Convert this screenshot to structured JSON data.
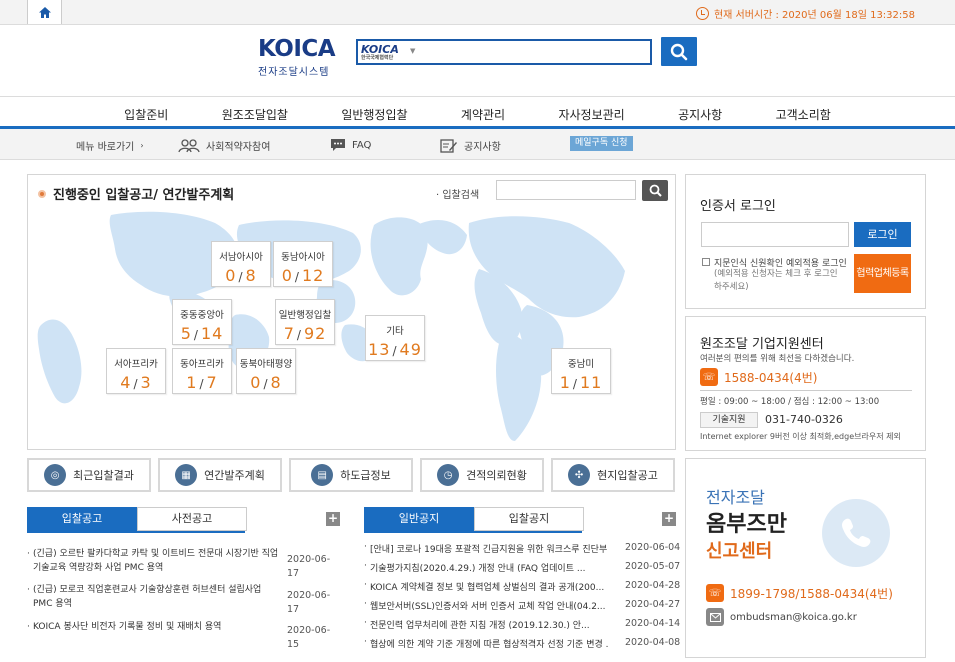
{
  "header": {
    "home_icon": "home-icon",
    "server_time_label": "현재 서버시간 : 2020년 06월 18일 13:32:58",
    "logo_main": "KOICA",
    "logo_sub": "전자조달시스템",
    "search_selector_brand": "KOICA",
    "search_selector_sub": "한국국제협력단",
    "search_placeholder": ""
  },
  "nav": {
    "items": [
      "입찰준비",
      "원조조달입찰",
      "일반행정입찰",
      "계약관리",
      "자사정보관리",
      "공지사항",
      "고객소리함"
    ]
  },
  "subnav": {
    "menu_shortcut": "메뉴 바로가기",
    "social": "사회적약자참여",
    "faq": "FAQ",
    "notice": "공지사항",
    "mail_subscribe": "메일구독 신청"
  },
  "bid_panel": {
    "title": "진행중인 입찰공고/ 연간발주계획",
    "search_label": "입찰검색",
    "regions": [
      {
        "name": "서남아시아",
        "a": "0",
        "b": "8"
      },
      {
        "name": "동남아시아",
        "a": "0",
        "b": "12"
      },
      {
        "name": "중동중앙아",
        "a": "5",
        "b": "14"
      },
      {
        "name": "일반행정입찰",
        "a": "7",
        "b": "92"
      },
      {
        "name": "기타",
        "a": "13",
        "b": "49"
      },
      {
        "name": "서아프리카",
        "a": "4",
        "b": "3"
      },
      {
        "name": "동아프리카",
        "a": "1",
        "b": "7"
      },
      {
        "name": "동북아태평양",
        "a": "0",
        "b": "8"
      },
      {
        "name": "중남미",
        "a": "1",
        "b": "11"
      }
    ]
  },
  "quick_links": [
    "최근입찰결과",
    "연간발주계획",
    "하도급정보",
    "견적의뢰현황",
    "현지입찰공고"
  ],
  "bid_notices": {
    "tab_active": "입찰공고",
    "tab_other": "사전공고",
    "items": [
      {
        "text": "(긴급) 오르탄 팔카다학교 카탁 및 이트비드 전문대 시장기반 직업기술교육 역량강화 사업 PMC 용역",
        "date": "2020-06-17"
      },
      {
        "text": "(긴급) 모로코 직업훈련교사 기술향상훈련 허브센터 설립사업 PMC 용역",
        "date": "2020-06-17"
      },
      {
        "text": "KOICA 봉사단 비전자 기록물 정비 및 재배치 용역",
        "date": "2020-06-15"
      }
    ]
  },
  "general_notices": {
    "tab_active": "일반공지",
    "tab_other": "입찰공지",
    "items": [
      {
        "text": "[안내] 코로나 19대응 포괄적 긴급지원을 위한 워크스루 진단부...",
        "date": "2020-06-04"
      },
      {
        "text": "기술평가지침(2020.4.29.) 개정 안내 (FAQ 업데이트 ...",
        "date": "2020-05-07"
      },
      {
        "text": "KOICA 계약체결 정보 및 협력업체 상벌심의 결과 공개(200...",
        "date": "2020-04-28"
      },
      {
        "text": "웹보안서버(SSL)인증서와 서버 인증서 교체 작업 안내(04.2...",
        "date": "2020-04-27"
      },
      {
        "text": "전문인력 업무처리에 관한 지침 개정 (2019.12.30.) 안...",
        "date": "2020-04-14"
      },
      {
        "text": "협상에 의한 계약 기준 개정에 따른 협상적격자 선정 기준 변경 ...",
        "date": "2020-04-08"
      }
    ]
  },
  "login": {
    "title": "인증서 로그인",
    "login_button": "로그인",
    "checkbox_label": "지문인식 신원확인 예외적용 로그인",
    "checkbox_note": "(예외적용 신청자는 체크 후 로그인 하주세요)",
    "register_button": "협력업체등록"
  },
  "support": {
    "title": "원조조달 기업지원센터",
    "subtitle": "여러분의 편의를 위해 최선을 다하겠습니다.",
    "phone": "1588-0434(4번)",
    "hours": "평일 : 09:00 ~ 18:00 / 점심 : 12:00 ~ 13:00",
    "tech_label": "기술지원",
    "tech_phone": "031-740-0326",
    "browser_note": "Internet explorer 9버전 이상 최적화,edge브라우저 제외"
  },
  "ombudsman": {
    "line1": "전자조달",
    "line2": "옴부즈만",
    "line3": "신고센터",
    "phone": "1899-1798/1588-0434(4번)",
    "email": "ombudsman@koica.go.kr"
  },
  "colors": {
    "brand_blue": "#1a6cc0",
    "accent_orange": "#f06b12",
    "map_blue": "#cfe3f5"
  }
}
